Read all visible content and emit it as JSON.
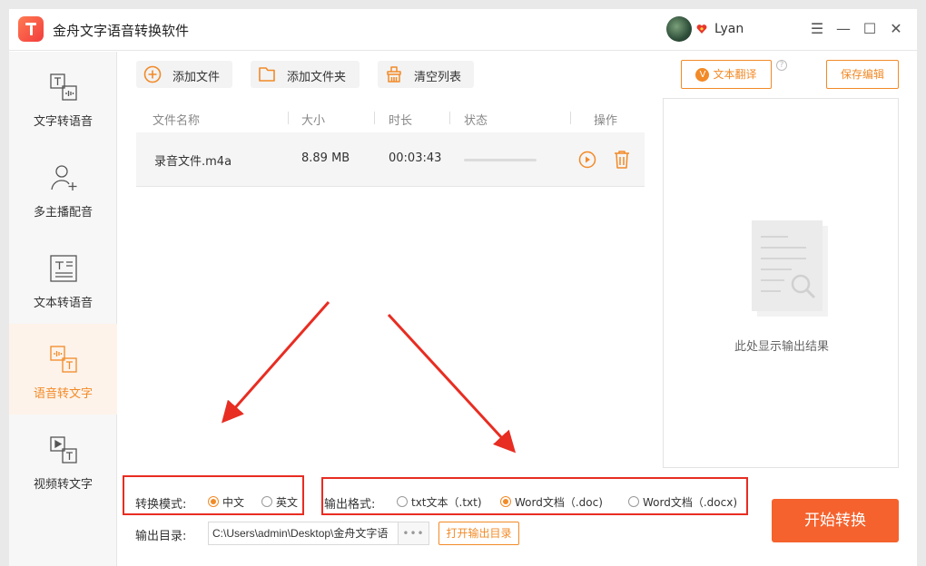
{
  "app": {
    "title": "金舟文字语音转换软件"
  },
  "user": {
    "name": "Lyan"
  },
  "window_controls": {
    "menu": "☰",
    "minimize": "—",
    "maximize": "☐",
    "close": "✕"
  },
  "sidebar": {
    "items": [
      {
        "label": "文字转语音",
        "icon": "text-to-speech-icon",
        "active": false
      },
      {
        "label": "多主播配音",
        "icon": "multi-anchor-icon",
        "active": false
      },
      {
        "label": "文本转语音",
        "icon": "document-to-speech-icon",
        "active": false
      },
      {
        "label": "语音转文字",
        "icon": "speech-to-text-icon",
        "active": true
      },
      {
        "label": "视频转文字",
        "icon": "video-to-text-icon",
        "active": false
      }
    ]
  },
  "toolbar": {
    "add_file": "添加文件",
    "add_folder": "添加文件夹",
    "clear_list": "清空列表",
    "text_translate": "文本翻译",
    "save_edit": "保存编辑"
  },
  "table": {
    "headers": {
      "name": "文件名称",
      "size": "大小",
      "duration": "时长",
      "status": "状态",
      "actions": "操作"
    },
    "rows": [
      {
        "name": "录音文件.m4a",
        "size": "8.89 MB",
        "duration": "00:03:43",
        "progress": 0
      }
    ]
  },
  "preview": {
    "placeholder": "此处显示输出结果"
  },
  "convert_mode": {
    "label": "转换模式:",
    "options": [
      {
        "label": "中文",
        "checked": true
      },
      {
        "label": "英文",
        "checked": false
      }
    ]
  },
  "output_format": {
    "label": "输出格式:",
    "options": [
      {
        "label": "txt文本（.txt)",
        "checked": false
      },
      {
        "label": "Word文档（.doc)",
        "checked": true
      },
      {
        "label": "Word文档（.docx)",
        "checked": false
      }
    ]
  },
  "output_dir": {
    "label": "输出目录:",
    "path": "C:\\Users\\admin\\Desktop\\金舟文字语",
    "browse": "•••",
    "open_label": "打开输出目录"
  },
  "start_button": "开始转换",
  "colors": {
    "accent": "#f28a27",
    "start": "#f5622d",
    "annotation": "#e82d22"
  }
}
